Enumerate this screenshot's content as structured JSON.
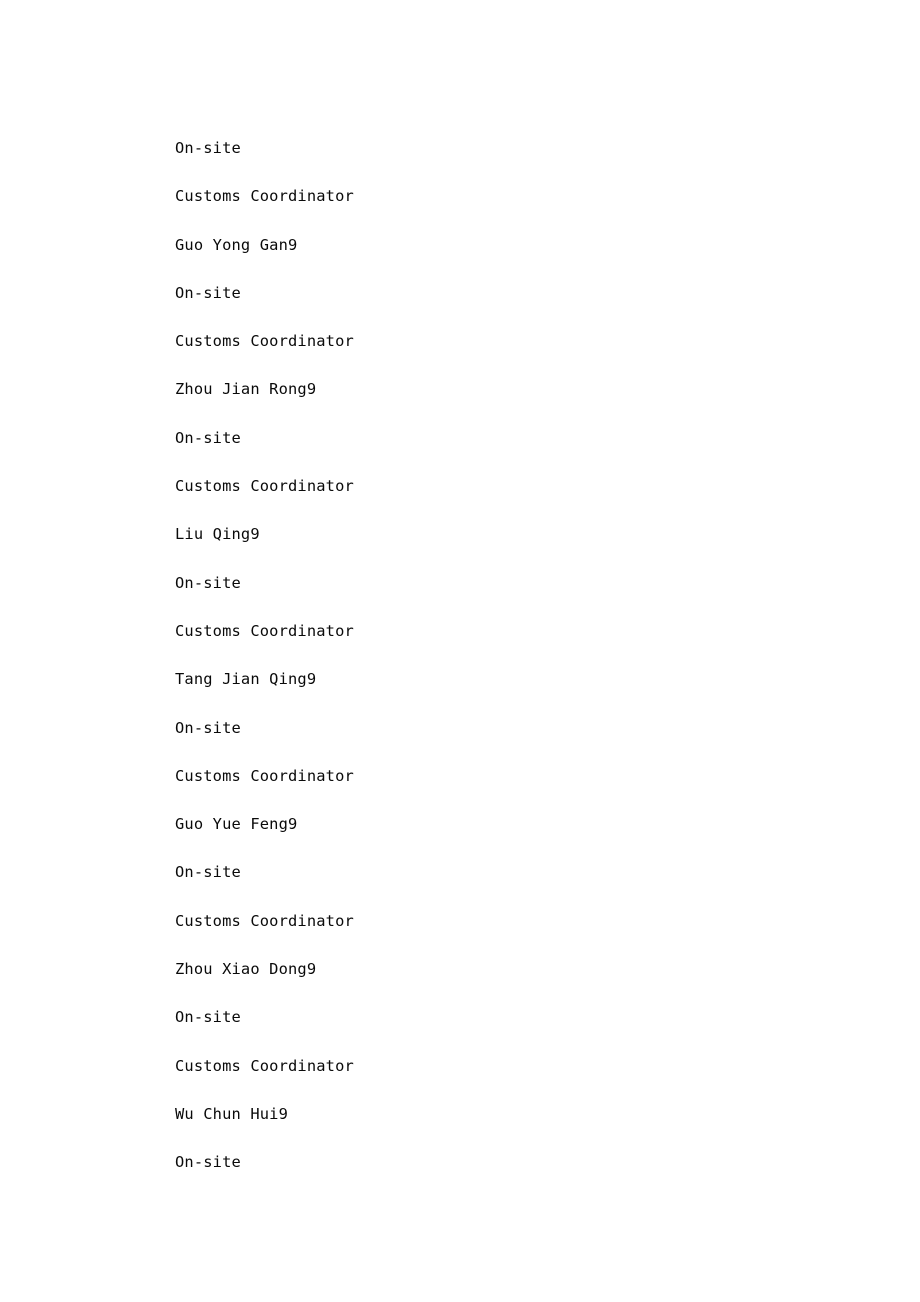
{
  "document": {
    "page_background": "#ffffff",
    "text_color": "#0a0a0a",
    "paragraphs": [
      {
        "text": "On-site",
        "kind": "work-arrangement"
      },
      {
        "text": "Customs Coordinator",
        "kind": "job-title"
      },
      {
        "text": "Guo Yong Gan9",
        "kind": "person-name"
      },
      {
        "text": "On-site",
        "kind": "work-arrangement"
      },
      {
        "text": "Customs Coordinator",
        "kind": "job-title"
      },
      {
        "text": "Zhou Jian Rong9",
        "kind": "person-name"
      },
      {
        "text": "On-site",
        "kind": "work-arrangement"
      },
      {
        "text": "Customs Coordinator",
        "kind": "job-title"
      },
      {
        "text": "Liu Qing9",
        "kind": "person-name"
      },
      {
        "text": "On-site",
        "kind": "work-arrangement"
      },
      {
        "text": "Customs Coordinator",
        "kind": "job-title"
      },
      {
        "text": "Tang Jian Qing9",
        "kind": "person-name"
      },
      {
        "text": "On-site",
        "kind": "work-arrangement"
      },
      {
        "text": "Customs Coordinator",
        "kind": "job-title"
      },
      {
        "text": "Guo Yue Feng9",
        "kind": "person-name"
      },
      {
        "text": "On-site",
        "kind": "work-arrangement"
      },
      {
        "text": "Customs Coordinator",
        "kind": "job-title"
      },
      {
        "text": "Zhou Xiao Dong9",
        "kind": "person-name"
      },
      {
        "text": "On-site",
        "kind": "work-arrangement"
      },
      {
        "text": "Customs Coordinator",
        "kind": "job-title"
      },
      {
        "text": "Wu Chun Hui9",
        "kind": "person-name"
      },
      {
        "text": "On-site",
        "kind": "work-arrangement"
      }
    ]
  }
}
